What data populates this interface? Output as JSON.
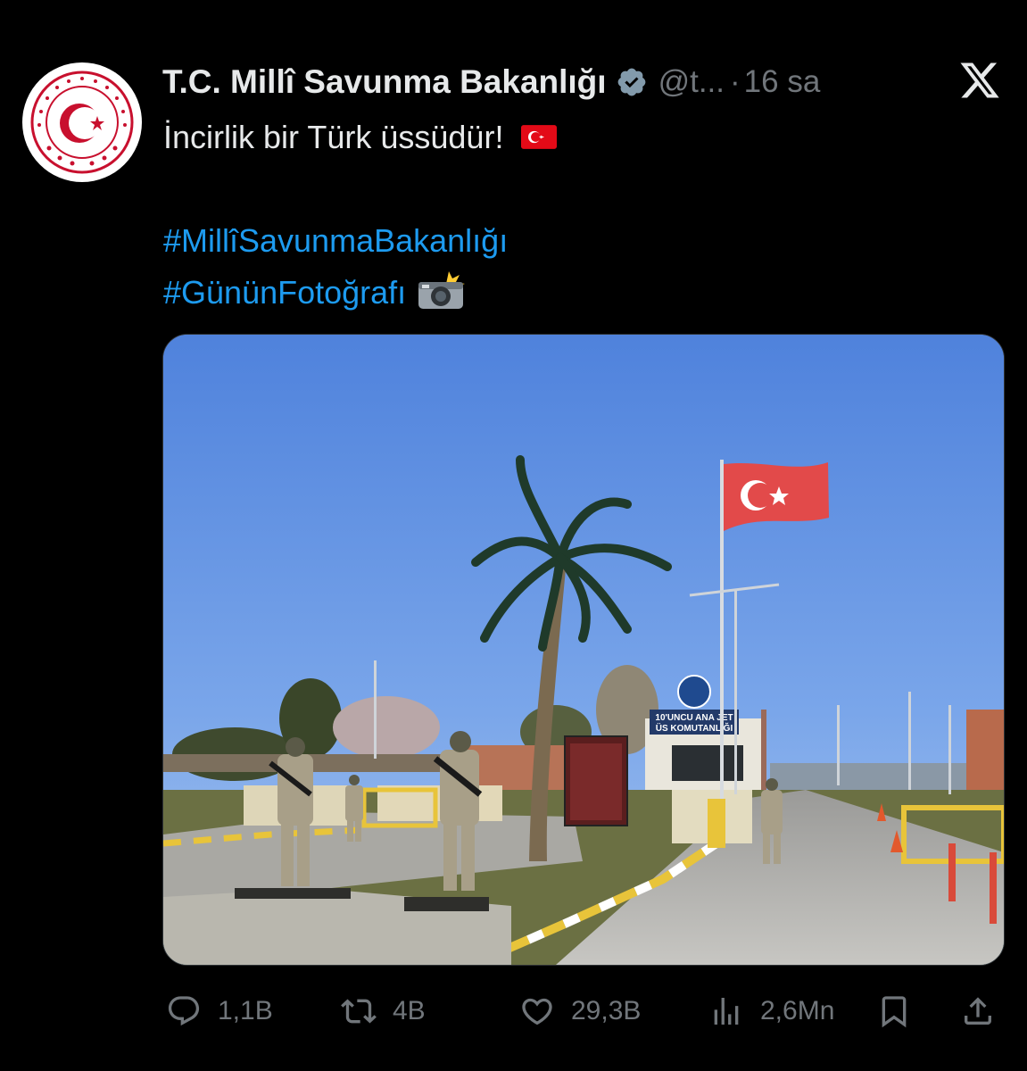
{
  "account": {
    "display_name": "T.C. Millî Savunma Bakanlığı",
    "handle": "@t...",
    "separator": "·",
    "time": "16 sa",
    "avatar_icon": "ministry-seal-icon",
    "verified_icon": "verified-badge-icon"
  },
  "tweet": {
    "line1": "İncirlik bir Türk üssüdür!",
    "hashtag1": "#MillîSavunmaBakanlığı",
    "hashtag2": "#GününFotoğrafı",
    "emoji_flag": "turkey-flag-emoji",
    "emoji_camera": "camera-flash-emoji"
  },
  "media": {
    "gate_sign_line1": "10'UNCU ANA JET",
    "gate_sign_line2": "ÜS KOMUTANLIĞI"
  },
  "actions": {
    "replies": "1,1B",
    "retweets": "4B",
    "likes": "29,3B",
    "views": "2,6Mn"
  },
  "colors": {
    "background": "#000000",
    "text": "#e7e9ea",
    "muted": "#71767b",
    "link": "#1d9bf0",
    "flag_red": "#e30a17"
  }
}
